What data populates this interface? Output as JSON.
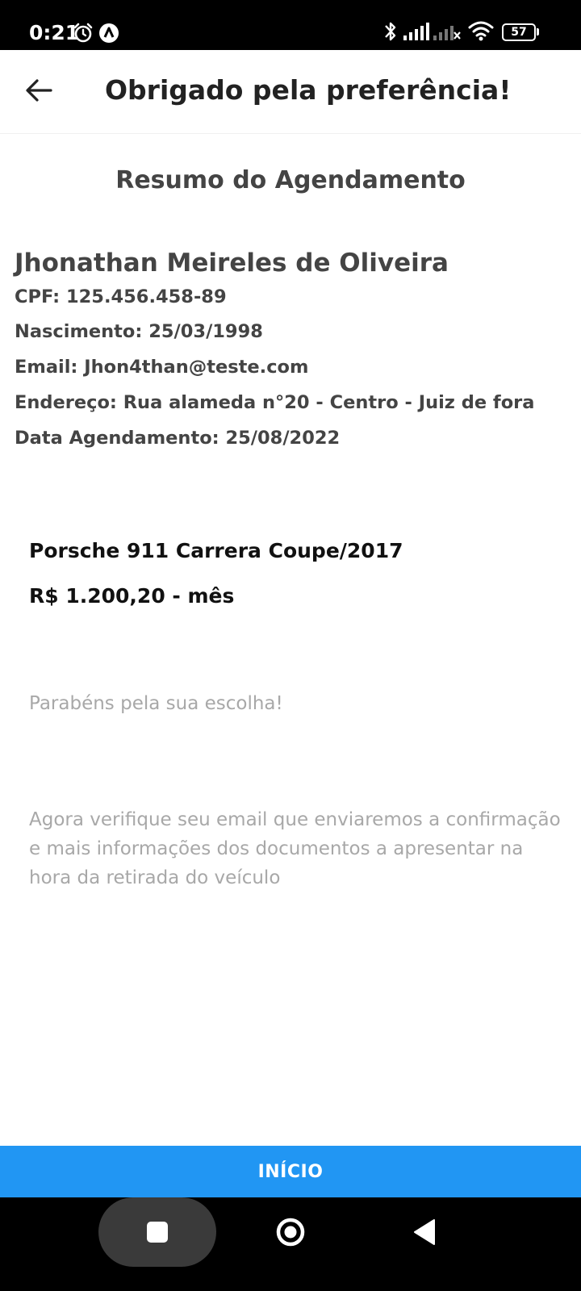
{
  "status_bar": {
    "time": "0:21",
    "battery": "57",
    "icons": [
      "alarm-icon",
      "notification-app-icon",
      "bluetooth-icon",
      "signal-icon",
      "signal-no-service-icon",
      "wifi-icon",
      "battery-icon"
    ]
  },
  "app_bar": {
    "title": "Obrigado pela preferência!",
    "back_icon": "arrow-left-icon"
  },
  "summary": {
    "title": "Resumo do Agendamento",
    "name": "Jhonathan Meireles de Oliveira",
    "cpf": "CPF: 125.456.458-89",
    "birth": "Nascimento: 25/03/1998",
    "email": "Email: Jhon4than@teste.com",
    "address": "Endereço: Rua alameda n°20 - Centro - Juiz de fora",
    "schedule_date": "Data Agendamento: 25/08/2022"
  },
  "car": {
    "name": "Porsche 911 Carrera Coupe/2017",
    "price": "R$ 1.200,20 - mês"
  },
  "messages": {
    "congrats": "Parabéns pela sua escolha!",
    "instructions": "Agora verifique seu email que enviaremos a confirmação e mais informações dos documentos a apresentar na hora da retirada do veículo"
  },
  "footer": {
    "button_label": "INÍCIO",
    "button_color": "#2196f3"
  },
  "nav_bar": {
    "icons": [
      "recent-apps-icon",
      "home-icon",
      "back-triangle-icon"
    ]
  }
}
